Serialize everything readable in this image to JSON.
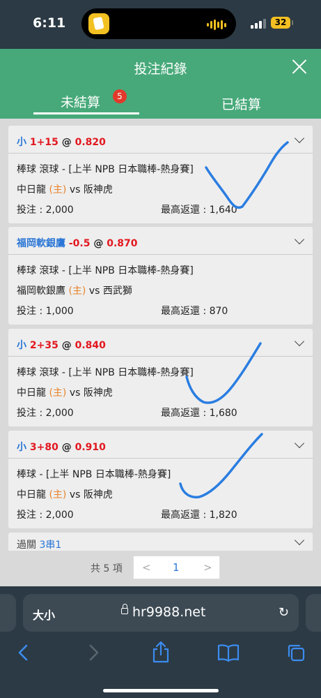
{
  "status": {
    "time": "6:11",
    "battery": "32"
  },
  "header": {
    "title": "投注紀錄"
  },
  "tabs": {
    "pending": "未結算",
    "pending_count": "5",
    "settled": "已結算"
  },
  "bets": [
    {
      "selection": "小",
      "line": "1+15",
      "at": "@",
      "odds": "0.820",
      "league": "棒球 滾球 - [上半 NPB 日本職棒-熱身賽]",
      "home": "中日龍",
      "home_tag": "(主)",
      "vs": "vs",
      "away": "阪神虎",
      "stake_label": "投注 : 2,000",
      "return_label": "最高返還 : 1,640"
    },
    {
      "selection": "福岡軟銀鷹",
      "line": "-0.5",
      "at": "@",
      "odds": "0.870",
      "league": "棒球 滾球 - [上半 NPB 日本職棒-熱身賽]",
      "home": "福岡軟銀鷹",
      "home_tag": "(主)",
      "vs": "vs",
      "away": "西武獅",
      "stake_label": "投注 : 1,000",
      "return_label": "最高返還 : 870"
    },
    {
      "selection": "小",
      "line": "2+35",
      "at": "@",
      "odds": "0.840",
      "league": "棒球 滾球 - [上半 NPB 日本職棒-熱身賽]",
      "home": "中日龍",
      "home_tag": "(主)",
      "vs": "vs",
      "away": "阪神虎",
      "stake_label": "投注 : 2,000",
      "return_label": "最高返還 : 1,680"
    },
    {
      "selection": "小",
      "line": "3+80",
      "at": "@",
      "odds": "0.910",
      "league": "棒球 - [上半 NPB 日本職棒-熱身賽]",
      "home": "中日龍",
      "home_tag": "(主)",
      "vs": "vs",
      "away": "阪神虎",
      "stake_label": "投注 : 2,000",
      "return_label": "最高返還 : 1,820"
    }
  ],
  "parlay": {
    "label": "過關",
    "value": "3串1"
  },
  "pager": {
    "total": "共 5 項",
    "prev": "<",
    "current": "1",
    "next": ">"
  },
  "browser": {
    "text_size": "大小",
    "url": "hr9988.net",
    "reload": "↻"
  },
  "colors": {
    "accent_green": "#47a97a",
    "blue": "#2a76d6",
    "red": "#e3171f",
    "orange": "#e8832a",
    "badge_red": "#e3382b",
    "check_blue": "#2a7de1"
  },
  "icons": [
    "close-icon",
    "chevron-down-icon",
    "lock-icon",
    "reload-icon",
    "back-icon",
    "forward-icon",
    "share-icon",
    "bookmarks-icon",
    "tabs-icon"
  ]
}
